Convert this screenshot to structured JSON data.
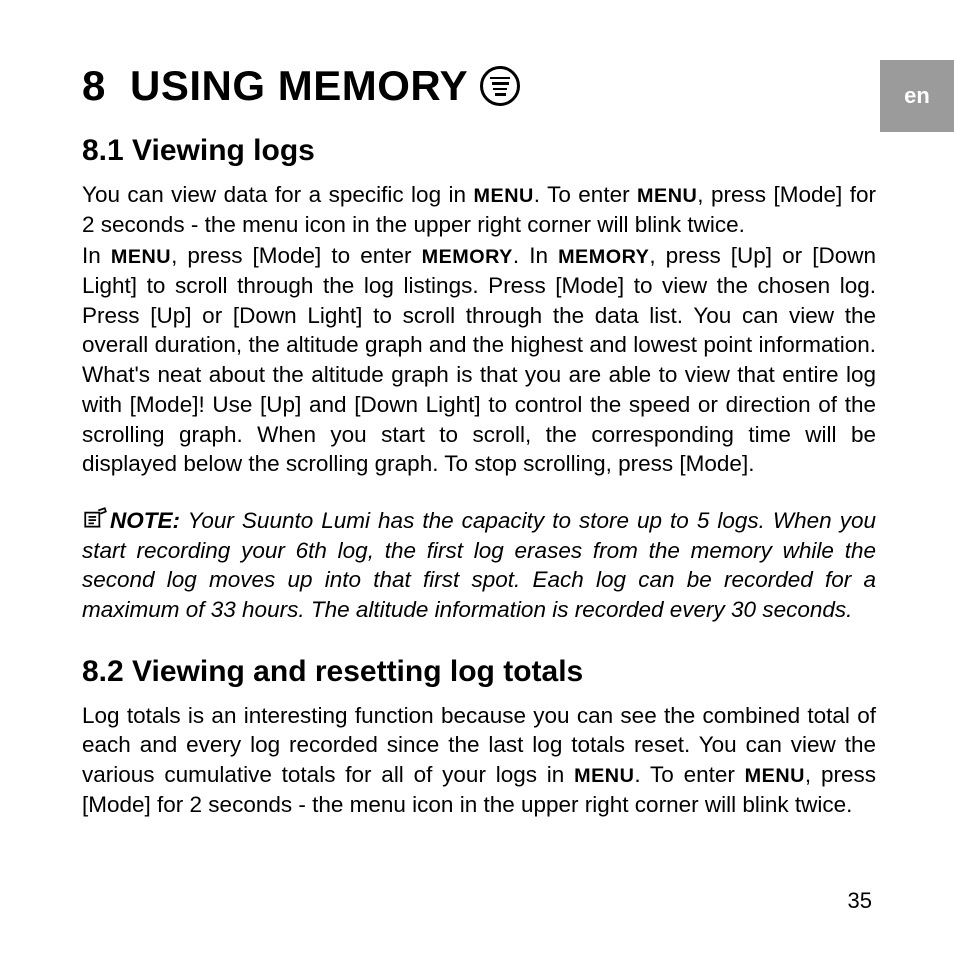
{
  "langTab": "en",
  "chapter": {
    "number": "8",
    "title": "USING MEMORY"
  },
  "section1": {
    "heading": "8.1  Viewing logs",
    "p1a": "You can view data for a specific log in ",
    "p1b": ". To enter ",
    "p1c": ", press [Mode] for 2 seconds - the menu icon in the upper right corner will blink twice.",
    "p2a": "In ",
    "p2b": ", press [Mode] to enter ",
    "p2c": ". In ",
    "p2d": ", press [Up] or [Down Light] to scroll through the log listings. Press [Mode] to view the chosen log. Press [Up] or [Down Light] to scroll through the data list. You can view the overall duration, the altitude graph and the highest and lowest point information. What's neat about the altitude graph is that you are able to view that entire log with [Mode]! Use [Up] and [Down Light] to control the speed or direction of the scrolling graph. When you start to scroll, the corresponding time will be displayed below the scrolling graph. To stop scrolling, press [Mode].",
    "menu": "MENU",
    "memory": "MEMORY"
  },
  "note": {
    "label": "NOTE:",
    "text": " Your Suunto Lumi has the capacity to store up to 5 logs. When you start recording your 6th log, the first log erases from the memory while the second log moves up into that first spot. Each log can be recorded for a maximum of 33 hours. The altitude information is recorded every 30 seconds."
  },
  "section2": {
    "heading": "8.2  Viewing and resetting log totals",
    "p1a": "Log totals is an interesting function because you can see the combined total of each and every log recorded since the last log totals reset. You can view the various cumulative totals for all of your logs in ",
    "p1b": ". To enter ",
    "p1c": ", press [Mode] for 2 seconds - the menu icon in the upper right corner will blink twice.",
    "menu": "MENU"
  },
  "pageNumber": "35"
}
